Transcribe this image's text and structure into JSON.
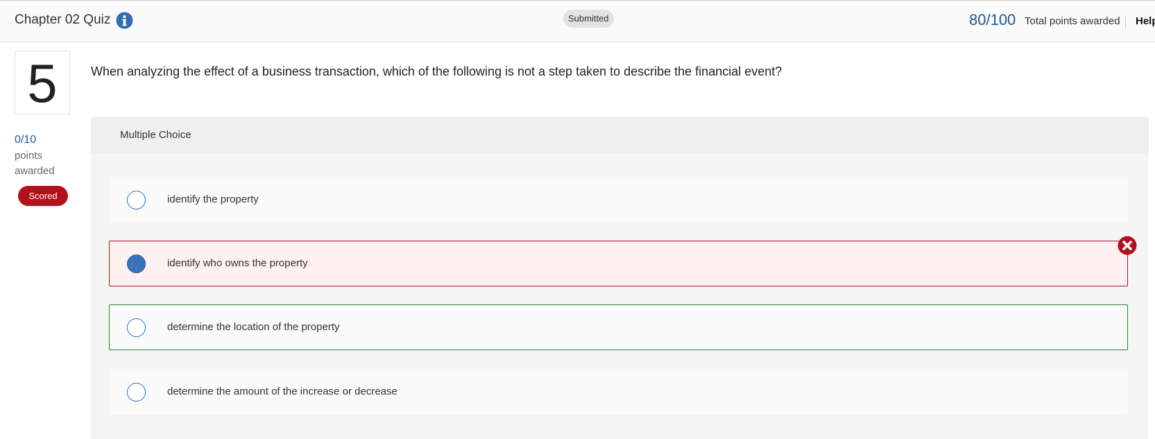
{
  "header": {
    "title": "Chapter 02 Quiz",
    "info_icon": "info-circle-icon",
    "status": "Submitted",
    "score": "80/100",
    "score_label": "Total points awarded",
    "help_label": "Help"
  },
  "question": {
    "number": "5",
    "points": "0/10",
    "points_unit": "points",
    "points_word": "awarded",
    "status_badge": "Scored",
    "text": "When analyzing the effect of a business transaction, which of the following is not a step taken to describe the financial event?"
  },
  "choices": {
    "type_label": "Multiple Choice",
    "options": [
      {
        "label": "identify the property",
        "selected": false,
        "state": "neutral"
      },
      {
        "label": "identify who owns the property",
        "selected": true,
        "state": "incorrect"
      },
      {
        "label": "determine the location of the property",
        "selected": false,
        "state": "correct"
      },
      {
        "label": "determine the amount of the increase or decrease",
        "selected": false,
        "state": "neutral"
      }
    ],
    "incorrect_icon": "x-circle-icon"
  },
  "colors": {
    "accent_blue": "#1f5797",
    "incorrect_red": "#b1121b",
    "correct_green": "#2f7d32"
  }
}
